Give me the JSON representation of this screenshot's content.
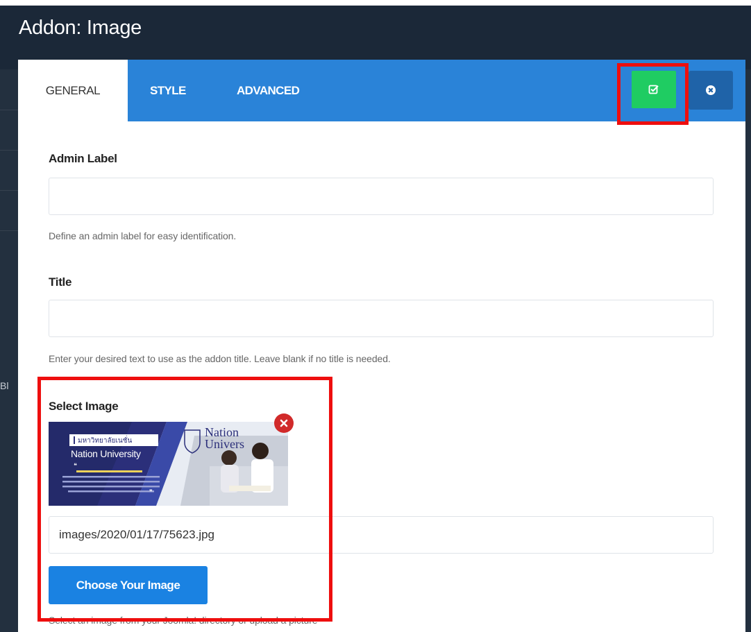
{
  "modal": {
    "title": "Addon: Image",
    "tabs": [
      {
        "label": "GENERAL",
        "active": true
      },
      {
        "label": "STYLE",
        "active": false
      },
      {
        "label": "ADVANCED",
        "active": false
      }
    ],
    "actions": {
      "apply_icon": "check-square-icon",
      "close_icon": "times-circle-icon"
    }
  },
  "form": {
    "admin_label": {
      "label": "Admin Label",
      "value": "",
      "help": "Define an admin label for easy identification."
    },
    "title": {
      "label": "Title",
      "value": "",
      "help": "Enter your desired text to use as the addon title. Leave blank if no title is needed."
    },
    "select_image": {
      "label": "Select Image",
      "path": "images/2020/01/17/75623.jpg",
      "choose_button": "Choose Your Image",
      "help": "Select an image from your Joomla! directory or upload a picture",
      "thumbnail": {
        "badge": "มหาวิทยาลัยเนชั่น",
        "brand": "Nation University",
        "logo_line1": "Nation",
        "logo_line2": "Univers"
      }
    }
  },
  "background": {
    "peek_text": "Bl"
  },
  "colors": {
    "tab_bar": "#2a83d8",
    "apply_button": "#1fcc62",
    "close_button": "#1f63a8",
    "primary_button": "#1a82e2",
    "highlight": "#ee0e0e",
    "remove": "#d12a2a"
  }
}
